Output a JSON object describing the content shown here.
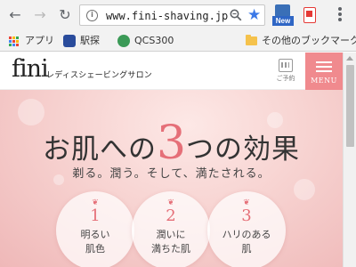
{
  "browser": {
    "back_icon": "back-arrow-icon",
    "forward_icon": "forward-arrow-icon",
    "reload_icon": "reload-icon",
    "url": "www.fini-shaving.jp",
    "extension_badge_label": "New",
    "bookmarks": [
      {
        "label": "アプリ",
        "icon": "apps-grid-icon"
      },
      {
        "label": "駅探",
        "icon": "ekitan-icon"
      },
      {
        "label": "QCS300",
        "icon": "qcs-icon"
      }
    ],
    "other_bookmarks": "その他のブックマーク"
  },
  "site": {
    "logo": "fini",
    "logo_subtitle": "レディスシェービングサロン",
    "reserve_label": "ご予約",
    "menu_label": "MENU",
    "accent_color": "#f08a8e"
  },
  "hero": {
    "title_pre": "お肌への",
    "title_number": "3",
    "title_post": "つの効果",
    "subtitle": "剃る。潤う。そして、満たされる。",
    "effects": [
      {
        "number": "1",
        "label": "明るい\n肌色"
      },
      {
        "number": "2",
        "label": "潤いに\n満ちた肌"
      },
      {
        "number": "3",
        "label": "ハリのある\n肌"
      }
    ]
  }
}
